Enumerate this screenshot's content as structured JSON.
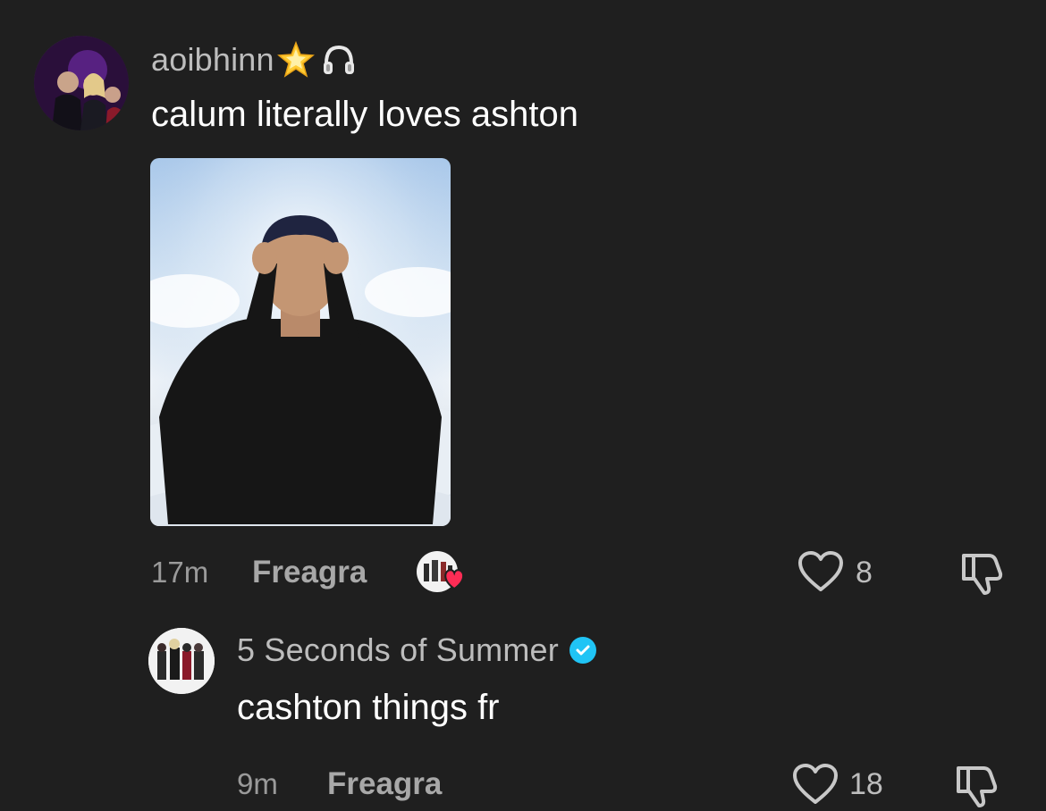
{
  "comment": {
    "username": "aoibhinn",
    "text": "calum literally loves ashton",
    "time": "17m",
    "reply_label": "Freagra",
    "likes": "8",
    "badges": [
      "glowing-star-icon",
      "headphones-icon"
    ],
    "gif_alt": "man with hands on temples in clouds"
  },
  "reply": {
    "username": "5 Seconds of Summer",
    "verified": true,
    "text": "cashton things fr",
    "time": "9m",
    "reply_label": "Freagra",
    "likes": "18"
  },
  "colors": {
    "background": "#1f1f1f",
    "username": "#bdbdbd",
    "verified": "#20c4f5",
    "heart_badge": "#fe2c55"
  }
}
